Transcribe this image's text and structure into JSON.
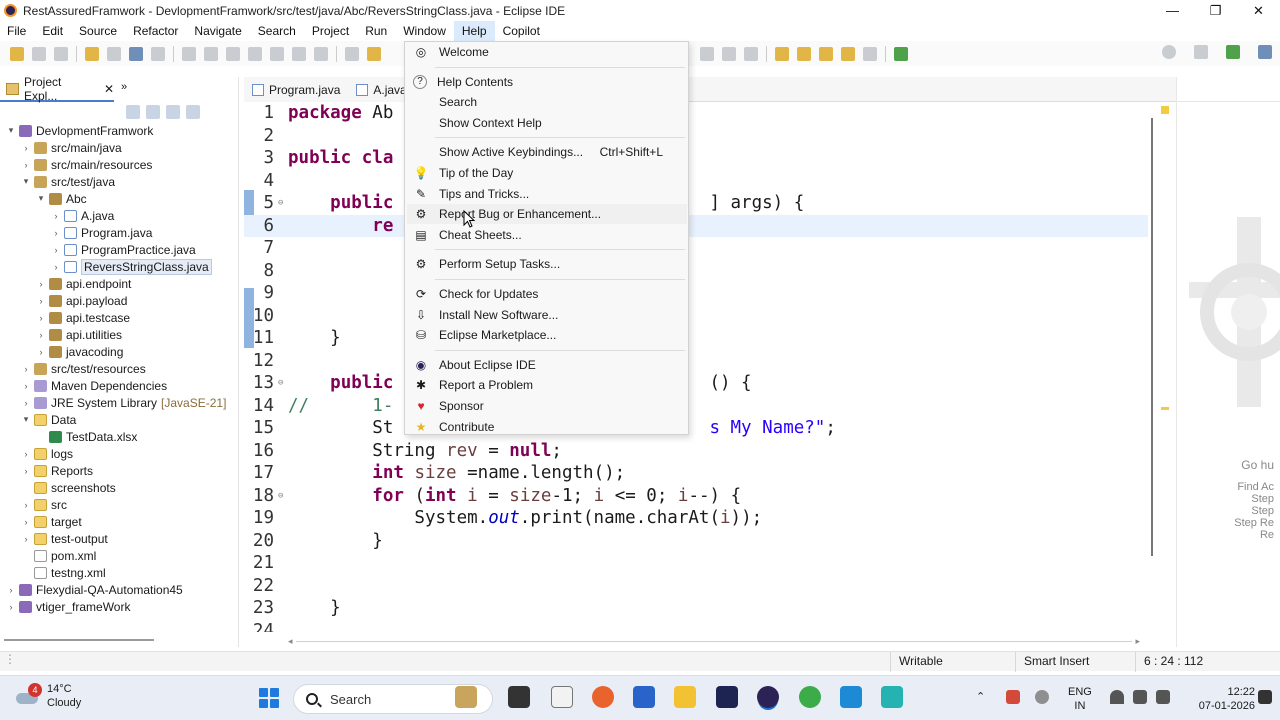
{
  "window": {
    "title": "RestAssuredFramwork - DevlopmentFramwork/src/test/java/Abc/ReversStringClass.java - Eclipse IDE",
    "controls": [
      "—",
      "❐",
      "✕"
    ]
  },
  "menubar": {
    "items": [
      "File",
      "Edit",
      "Source",
      "Refactor",
      "Navigate",
      "Search",
      "Project",
      "Run",
      "Window",
      "Help",
      "Copilot"
    ]
  },
  "explorer": {
    "tab_label": "Project Expl...",
    "close": "✕",
    "more": "»",
    "tree": [
      {
        "label": "DevlopmentFramwork",
        "indent": 0,
        "arrow": "▾",
        "icon": "proj"
      },
      {
        "label": "src/main/java",
        "indent": 1,
        "arrow": "›",
        "icon": "pkgfolder"
      },
      {
        "label": "src/main/resources",
        "indent": 1,
        "arrow": "›",
        "icon": "pkgfolder"
      },
      {
        "label": "src/test/java",
        "indent": 1,
        "arrow": "▾",
        "icon": "pkgfolder"
      },
      {
        "label": "Abc",
        "indent": 2,
        "arrow": "▾",
        "icon": "pkg"
      },
      {
        "label": "A.java",
        "indent": 3,
        "arrow": "›",
        "icon": "java"
      },
      {
        "label": "Program.java",
        "indent": 3,
        "arrow": "›",
        "icon": "java"
      },
      {
        "label": "ProgramPractice.java",
        "indent": 3,
        "arrow": "›",
        "icon": "java"
      },
      {
        "label": "ReversStringClass.java",
        "indent": 3,
        "arrow": "›",
        "icon": "java",
        "selected": true
      },
      {
        "label": "api.endpoint",
        "indent": 2,
        "arrow": "›",
        "icon": "pkg"
      },
      {
        "label": "api.payload",
        "indent": 2,
        "arrow": "›",
        "icon": "pkg"
      },
      {
        "label": "api.testcase",
        "indent": 2,
        "arrow": "›",
        "icon": "pkg"
      },
      {
        "label": "api.utilities",
        "indent": 2,
        "arrow": "›",
        "icon": "pkg"
      },
      {
        "label": "javacoding",
        "indent": 2,
        "arrow": "›",
        "icon": "pkg"
      },
      {
        "label": "src/test/resources",
        "indent": 1,
        "arrow": "›",
        "icon": "pkgfolder"
      },
      {
        "label": "Maven Dependencies",
        "indent": 1,
        "arrow": "›",
        "icon": "lib"
      },
      {
        "label": "JRE System Library",
        "suffix": "[JavaSE-21]",
        "indent": 1,
        "arrow": "›",
        "icon": "lib"
      },
      {
        "label": "Data",
        "indent": 1,
        "arrow": "▾",
        "icon": "folder"
      },
      {
        "label": "TestData.xlsx",
        "indent": 2,
        "arrow": "",
        "icon": "xls"
      },
      {
        "label": "logs",
        "indent": 1,
        "arrow": "›",
        "icon": "folder"
      },
      {
        "label": "Reports",
        "indent": 1,
        "arrow": "›",
        "icon": "folder"
      },
      {
        "label": "screenshots",
        "indent": 1,
        "arrow": "",
        "icon": "folder"
      },
      {
        "label": "src",
        "indent": 1,
        "arrow": "›",
        "icon": "folder"
      },
      {
        "label": "target",
        "indent": 1,
        "arrow": "›",
        "icon": "folder"
      },
      {
        "label": "test-output",
        "indent": 1,
        "arrow": "›",
        "icon": "folder"
      },
      {
        "label": "pom.xml",
        "indent": 1,
        "arrow": "",
        "icon": "file"
      },
      {
        "label": "testng.xml",
        "indent": 1,
        "arrow": "",
        "icon": "file"
      },
      {
        "label": "Flexydial-QA-Automation45",
        "indent": 0,
        "arrow": "›",
        "icon": "proj"
      },
      {
        "label": "vtiger_frameWork",
        "indent": 0,
        "arrow": "›",
        "icon": "proj"
      }
    ]
  },
  "editor": {
    "tabs": [
      "Program.java",
      "A.java"
    ],
    "lines": [
      {
        "n": "1",
        "html": "<span class=\"kw\">package</span> Ab"
      },
      {
        "n": "2",
        "html": ""
      },
      {
        "n": "3",
        "html": "<span class=\"kw\">public</span> <span class=\"kw\">cla</span>"
      },
      {
        "n": "4",
        "html": ""
      },
      {
        "n": "5",
        "html": "    <span class=\"kw\">public</span>                              ] args) {",
        "fold": "⊖"
      },
      {
        "n": "6",
        "html": "        <span class=\"kw\">re</span>",
        "current": true
      },
      {
        "n": "7",
        "html": ""
      },
      {
        "n": "8",
        "html": ""
      },
      {
        "n": "9",
        "html": ""
      },
      {
        "n": "10",
        "html": ""
      },
      {
        "n": "11",
        "html": "    }"
      },
      {
        "n": "12",
        "html": ""
      },
      {
        "n": "13",
        "html": "    <span class=\"kw\">public</span>                              () {",
        "fold": "⊖"
      },
      {
        "n": "14",
        "html": "<span class=\"cmt\">//      1-</span>"
      },
      {
        "n": "15",
        "html": "        St                              <span class=\"str\">s My Name?\"</span>;"
      },
      {
        "n": "16",
        "html": "        String <span class=\"var\">rev</span> = <span class=\"kw\">null</span>;"
      },
      {
        "n": "17",
        "html": "        <span class=\"kw\">int</span> <span class=\"var\">size</span> =name.length();"
      },
      {
        "n": "18",
        "html": "        <span class=\"kw\">for</span> (<span class=\"kw\">int</span> <span class=\"var\">i</span> = <span class=\"var\">size</span>-1; <span class=\"var\">i</span> &lt;= 0; <span class=\"var\">i</span>--) {",
        "fold": "⊖"
      },
      {
        "n": "19",
        "html": "            System.<span class=\"fld\">out</span>.print(name.charAt(<span class=\"var\">i</span>));"
      },
      {
        "n": "20",
        "html": "        }"
      },
      {
        "n": "21",
        "html": ""
      },
      {
        "n": "22",
        "html": ""
      },
      {
        "n": "23",
        "html": "    }"
      },
      {
        "n": "24",
        "html": ""
      }
    ]
  },
  "help_menu": {
    "items": [
      {
        "label": "Welcome",
        "icon": "welcome-icon",
        "glyph": "◎"
      },
      {
        "sep": true
      },
      {
        "label": "Help Contents",
        "icon": "help-contents-icon",
        "glyph": "?"
      },
      {
        "label": "Search",
        "icon": "",
        "glyph": ""
      },
      {
        "label": "Show Context Help",
        "icon": "",
        "glyph": ""
      },
      {
        "sep": true
      },
      {
        "label": "Show Active Keybindings...",
        "accelerator": "Ctrl+Shift+L",
        "icon": "",
        "glyph": ""
      },
      {
        "label": "Tip of the Day",
        "icon": "lightbulb-icon",
        "glyph": "💡"
      },
      {
        "label": "Tips and Tricks...",
        "icon": "tips-icon",
        "glyph": "✎"
      },
      {
        "label": "Report Bug or Enhancement...",
        "icon": "bug-icon",
        "glyph": "⚙",
        "hover": true
      },
      {
        "label": "Cheat Sheets...",
        "icon": "cheat-sheet-icon",
        "glyph": "▤"
      },
      {
        "sep": true
      },
      {
        "label": "Perform Setup Tasks...",
        "icon": "setup-icon",
        "glyph": "⚙"
      },
      {
        "sep": true
      },
      {
        "label": "Check for Updates",
        "icon": "update-icon",
        "glyph": "⟳"
      },
      {
        "label": "Install New Software...",
        "icon": "install-icon",
        "glyph": "⇩"
      },
      {
        "label": "Eclipse Marketplace...",
        "icon": "marketplace-icon",
        "glyph": "⛁"
      },
      {
        "sep": true
      },
      {
        "label": "About Eclipse IDE",
        "icon": "eclipse-icon",
        "glyph": "◉"
      },
      {
        "label": "Report a Problem",
        "icon": "problem-icon",
        "glyph": "✱"
      },
      {
        "label": "Sponsor",
        "icon": "heart-icon",
        "glyph": "♥"
      },
      {
        "label": "Contribute",
        "icon": "star-icon",
        "glyph": "★"
      }
    ]
  },
  "side_panel": {
    "texts": [
      "Go hu",
      "Find Ac",
      "Step",
      "Step",
      "Step Re",
      "Re"
    ]
  },
  "statusbar": {
    "mode": "Writable",
    "insert": "Smart Insert",
    "position": "6 : 24 : 112"
  },
  "taskbar": {
    "weather_temp": "14°C",
    "weather_desc": "Cloudy",
    "weather_badge": "4",
    "search_placeholder": "Search",
    "lang_1": "ENG",
    "lang_2": "IN",
    "time": "12:22",
    "date": "07-01-2026"
  },
  "colors": {
    "accent": "#4a7cc9",
    "keyword": "#7f0055",
    "string": "#2a00ff",
    "comment": "#3f7f5f"
  }
}
